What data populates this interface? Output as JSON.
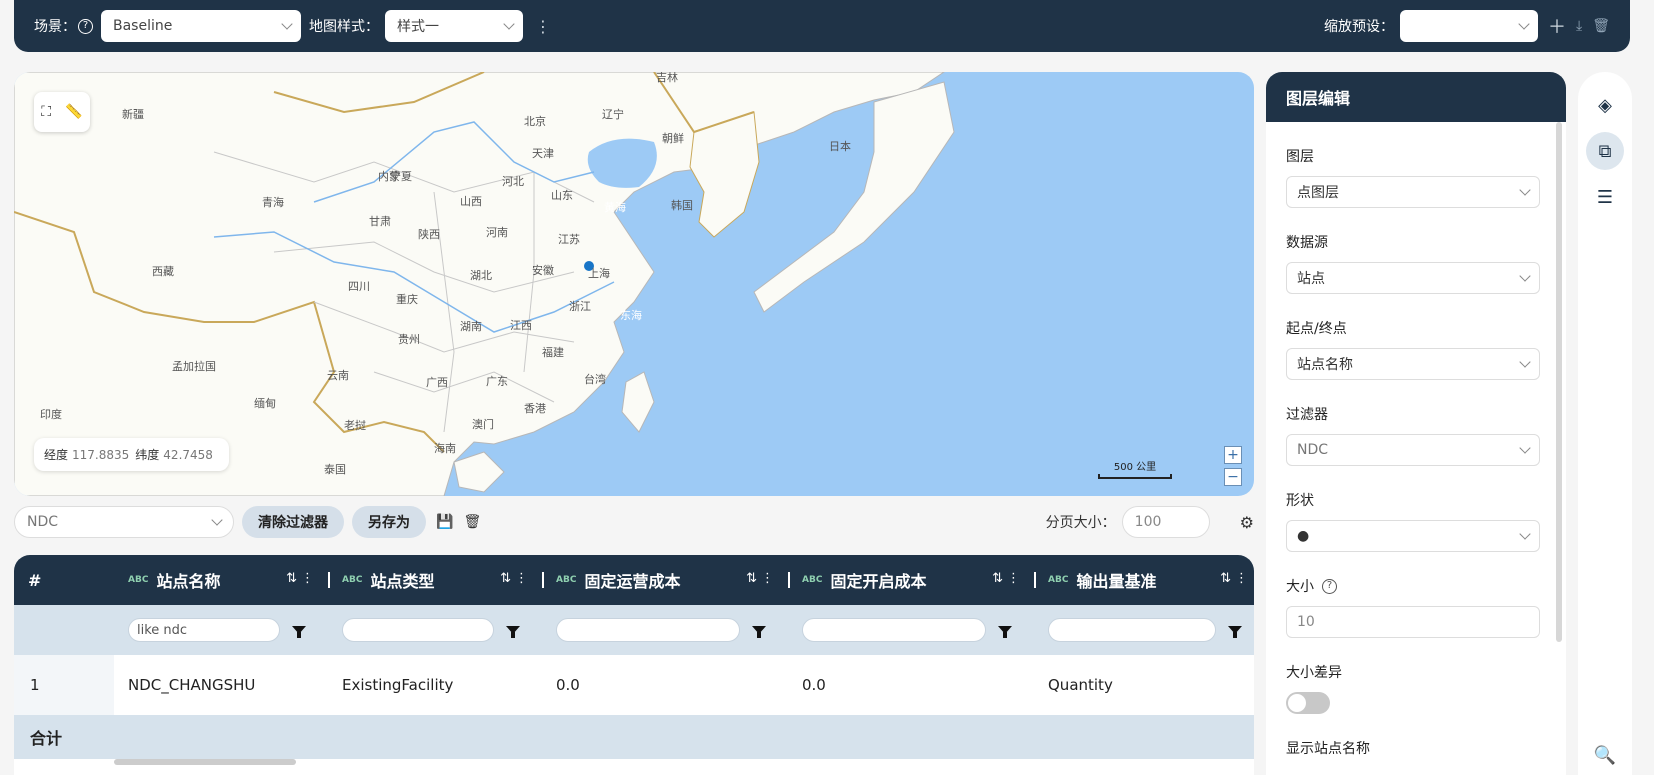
{
  "topbar": {
    "scene_label": "场景：",
    "scene_value": "Baseline",
    "style_label": "地图样式：",
    "style_value": "样式一",
    "zoom_preset_label": "缩放预设：",
    "zoom_preset_value": ""
  },
  "map": {
    "labels": [
      "新疆",
      "青海",
      "西藏",
      "甘肃",
      "宁夏",
      "内蒙",
      "四川",
      "重庆",
      "陕西",
      "山西",
      "河北",
      "北京",
      "天津",
      "辽宁",
      "吉林",
      "朝鲜",
      "韩国",
      "日本",
      "山东",
      "河南",
      "江苏",
      "安徽",
      "湖北",
      "上海",
      "浙江",
      "湖南",
      "江西",
      "贵州",
      "云南",
      "广西",
      "广东",
      "福建",
      "台湾",
      "香港",
      "澳门",
      "海南",
      "黄海",
      "东海",
      "孟加拉国",
      "缅甸",
      "老挝",
      "印度",
      "泰国"
    ],
    "coords": {
      "lon_label": "经度",
      "lon_value": "117.8835",
      "lat_label": "纬度",
      "lat_value": "42.7458"
    },
    "scale": "500 公里",
    "zoom_in": "+",
    "zoom_out": "−"
  },
  "filterbar": {
    "filter_value": "NDC",
    "clear_label": "清除过滤器",
    "save_as_label": "另存为",
    "page_size_label": "分页大小：",
    "page_size_value": "100"
  },
  "table": {
    "index_header": "#",
    "columns": [
      {
        "type": "ABC",
        "label": "站点名称",
        "filter": "like ndc"
      },
      {
        "type": "ABC",
        "label": "站点类型",
        "filter": ""
      },
      {
        "type": "ABC",
        "label": "固定运营成本",
        "filter": ""
      },
      {
        "type": "ABC",
        "label": "固定开启成本",
        "filter": ""
      },
      {
        "type": "ABC",
        "label": "输出量基准",
        "filter": ""
      }
    ],
    "rows": [
      {
        "index": "1",
        "cells": [
          "NDC_CHANGSHU",
          "ExistingFacility",
          "0.0",
          "0.0",
          "Quantity"
        ]
      }
    ],
    "total_label": "合计"
  },
  "panel": {
    "title": "图层编辑",
    "layer_label": "图层",
    "layer_value": "点图层",
    "datasource_label": "数据源",
    "datasource_value": "站点",
    "endpoint_label": "起点/终点",
    "endpoint_value": "站点名称",
    "filter_label": "过滤器",
    "filter_value": "NDC",
    "shape_label": "形状",
    "shape_value": "●",
    "size_label": "大小",
    "size_value": "10",
    "size_diff_label": "大小差异",
    "size_diff_on": false,
    "show_name_label": "显示站点名称"
  },
  "colors": {
    "navy": "#1f3347",
    "sea": "#9dcaf5",
    "land": "#fbfbf6",
    "border": "#c9a85a",
    "accent_dot": "#1875c7"
  }
}
